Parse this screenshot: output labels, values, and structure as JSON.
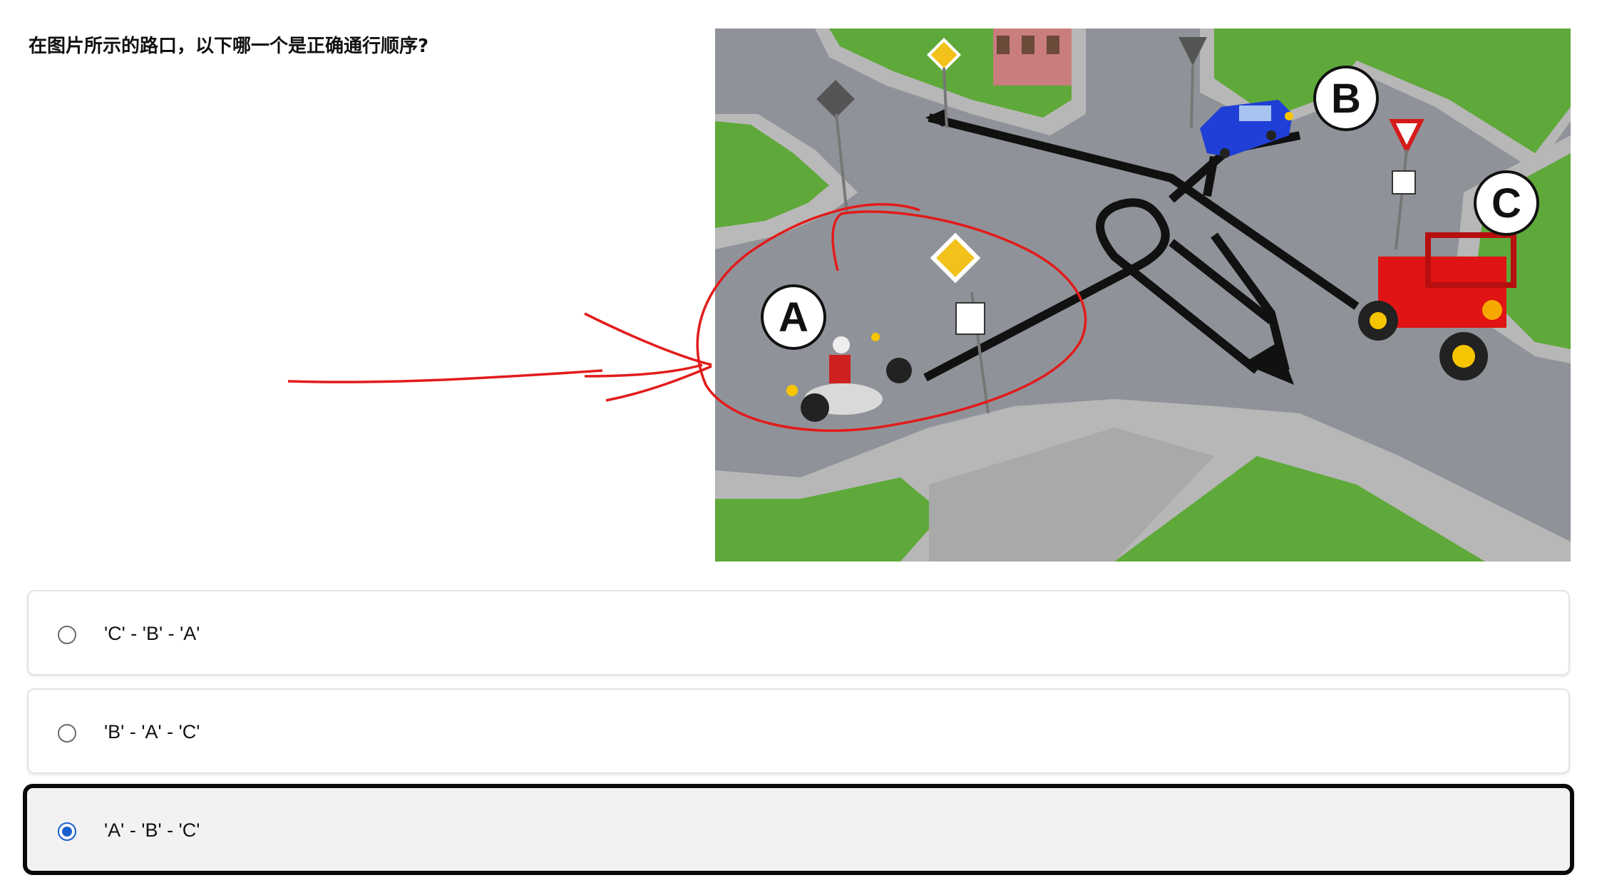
{
  "question": {
    "text": "在图片所示的路口，以下哪一个是正确通行顺序?"
  },
  "scene": {
    "vehicle_labels": [
      "A",
      "B",
      "C"
    ],
    "colors": {
      "road": "#8f9399",
      "grass": "#5fa83a",
      "sidewalk": "#b7b7b7",
      "arrow": "#111111",
      "car_b": "#1f3fd6",
      "tractor_c": "#e01414",
      "annotation_red": "#e21b1b"
    }
  },
  "options": [
    {
      "label": "'C' - 'B' - 'A'",
      "selected": false
    },
    {
      "label": "'B' - 'A' - 'C'",
      "selected": false
    },
    {
      "label": "'A' - 'B' - 'C'",
      "selected": true
    }
  ]
}
